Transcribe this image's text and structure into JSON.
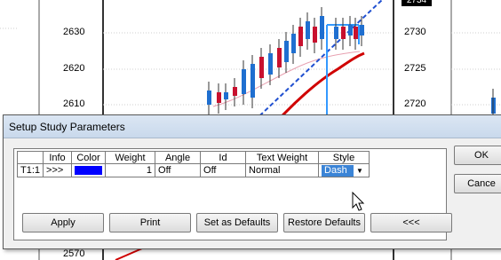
{
  "chart": {
    "price_axis_left": [
      "2630",
      "2620",
      "2610",
      "2570"
    ],
    "price_axis_right": [
      "2734",
      "2730",
      "2725",
      "2720"
    ],
    "colors": {
      "candle_up": "#1f6fd0",
      "candle_down": "#c8102e",
      "ma_fast": "#e8a0b0",
      "ma_slow": "#d00000",
      "trend": "#2050d0",
      "cursor_line": "#3399ff"
    }
  },
  "dialog": {
    "title": "Setup Study Parameters",
    "columns": [
      "Info",
      "Color",
      "Weight",
      "Angle",
      "Id",
      "Text Weight",
      "Style"
    ],
    "rows": [
      {
        "row_label": "T1:1",
        "info": ">>>",
        "color": "#0000ff",
        "weight": "1",
        "angle": "Off",
        "id": "Off",
        "text_weight": "Normal",
        "style": "Dash"
      }
    ],
    "buttons": {
      "apply": "Apply",
      "print": "Print",
      "set_defaults": "Set as Defaults",
      "restore_defaults": "Restore Defaults",
      "collapse": "<<<",
      "ok": "OK",
      "cancel": "Cance"
    }
  }
}
